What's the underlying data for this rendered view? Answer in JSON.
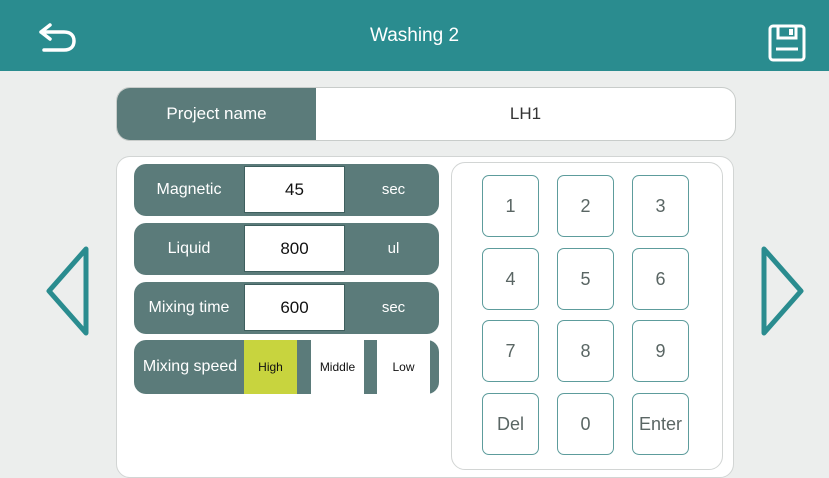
{
  "header": {
    "title": "Washing 2",
    "back_icon": "back-arrow-icon",
    "save_icon": "save-icon",
    "color": "#2a8c8f"
  },
  "project": {
    "label": "Project name",
    "value": "LH1"
  },
  "params": [
    {
      "label": "Magnetic",
      "value": "45",
      "unit": "sec"
    },
    {
      "label": "Liquid",
      "value": "800",
      "unit": "ul"
    },
    {
      "label": "Mixing time",
      "value": "600",
      "unit": "sec"
    }
  ],
  "mixing_speed": {
    "label": "Mixing speed",
    "options": [
      "High",
      "Middle",
      "Low"
    ],
    "selected": "High",
    "selected_color": "#c8d43e"
  },
  "keypad": {
    "keys": [
      "1",
      "2",
      "3",
      "4",
      "5",
      "6",
      "7",
      "8",
      "9",
      "Del",
      "0",
      "Enter"
    ]
  },
  "nav": {
    "prev_icon": "chevron-left-icon",
    "next_icon": "chevron-right-icon",
    "color": "#2a8c8f"
  }
}
